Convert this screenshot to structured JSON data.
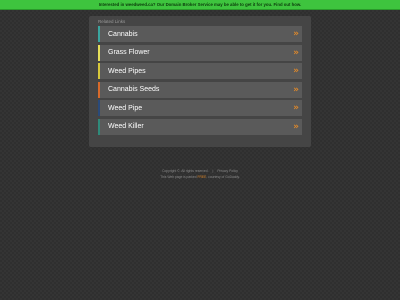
{
  "banner": {
    "text": "Interested in weedweed.ca? Our Domain Broker Service may be able to get it for you. Find out how."
  },
  "panel": {
    "header": "Related Links",
    "links": [
      {
        "label": "Cannabis",
        "accent": "#3aa6a0"
      },
      {
        "label": "Grass Flower",
        "accent": "#e6e05a"
      },
      {
        "label": "Weed Pipes",
        "accent": "#d8c83a"
      },
      {
        "label": "Cannabis Seeds",
        "accent": "#d86a2a"
      },
      {
        "label": "Weed Pipe",
        "accent": "#2a4a7a"
      },
      {
        "label": "Weed Killer",
        "accent": "#2f8a7a"
      }
    ],
    "arrow_icon": "double-chevron-right-icon",
    "arrow_glyph": "»",
    "arrow_color": "#e0892a"
  },
  "footer": {
    "copyright": "Copyright ©.  All rights reserved.",
    "separator": "|",
    "privacy": "Privacy Policy",
    "parked_prefix": "This Web page is parked",
    "parked_link": "FREE",
    "parked_suffix": ", courtesy of GoDaddy."
  }
}
